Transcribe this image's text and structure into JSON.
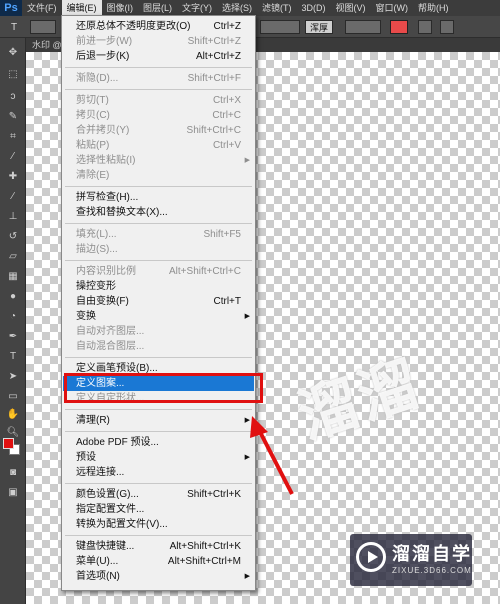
{
  "app": {
    "logo": "Ps"
  },
  "menubar": {
    "items": [
      "文件(F)",
      "编辑(E)",
      "图像(I)",
      "图层(L)",
      "文字(Y)",
      "选择(S)",
      "滤镜(T)",
      "3D(D)",
      "视图(V)",
      "窗口(W)",
      "帮助(H)"
    ],
    "active_index": 1
  },
  "options_bar": {
    "tool_glyph": "T",
    "aa_value": "浑厚",
    "text_color": "#e84a4a"
  },
  "document": {
    "tab_title": "水印 @"
  },
  "toolbox": {
    "foreground_color": "#e01010",
    "background_color": "#ffffff"
  },
  "edit_menu": {
    "items": [
      {
        "label": "还原总体不透明度更改(O)",
        "shortcut": "Ctrl+Z",
        "disabled": false
      },
      {
        "label": "前进一步(W)",
        "shortcut": "Shift+Ctrl+Z",
        "disabled": true
      },
      {
        "label": "后退一步(K)",
        "shortcut": "Alt+Ctrl+Z",
        "disabled": false
      },
      {
        "sep": true
      },
      {
        "label": "渐隐(D)...",
        "shortcut": "Shift+Ctrl+F",
        "disabled": true
      },
      {
        "sep": true
      },
      {
        "label": "剪切(T)",
        "shortcut": "Ctrl+X",
        "disabled": true
      },
      {
        "label": "拷贝(C)",
        "shortcut": "Ctrl+C",
        "disabled": true
      },
      {
        "label": "合并拷贝(Y)",
        "shortcut": "Shift+Ctrl+C",
        "disabled": true
      },
      {
        "label": "粘贴(P)",
        "shortcut": "Ctrl+V",
        "disabled": true
      },
      {
        "label": "选择性粘贴(I)",
        "shortcut": "",
        "submenu": true,
        "disabled": true
      },
      {
        "label": "清除(E)",
        "shortcut": "",
        "disabled": true
      },
      {
        "sep": true
      },
      {
        "label": "拼写检查(H)...",
        "shortcut": "",
        "disabled": false
      },
      {
        "label": "查找和替换文本(X)...",
        "shortcut": "",
        "disabled": false
      },
      {
        "sep": true
      },
      {
        "label": "填充(L)...",
        "shortcut": "Shift+F5",
        "disabled": true
      },
      {
        "label": "描边(S)...",
        "shortcut": "",
        "disabled": true
      },
      {
        "sep": true
      },
      {
        "label": "内容识别比例",
        "shortcut": "Alt+Shift+Ctrl+C",
        "disabled": true
      },
      {
        "label": "操控变形",
        "shortcut": "",
        "disabled": false
      },
      {
        "label": "自由变换(F)",
        "shortcut": "Ctrl+T",
        "disabled": false
      },
      {
        "label": "变换",
        "shortcut": "",
        "submenu": true,
        "disabled": false
      },
      {
        "label": "自动对齐图层...",
        "shortcut": "",
        "disabled": true
      },
      {
        "label": "自动混合图层...",
        "shortcut": "",
        "disabled": true
      },
      {
        "sep": true
      },
      {
        "label": "定义画笔预设(B)...",
        "shortcut": "",
        "disabled": false
      },
      {
        "label": "定义图案...",
        "shortcut": "",
        "disabled": false,
        "highlighted": true
      },
      {
        "label": "定义自定形状...",
        "shortcut": "",
        "disabled": true
      },
      {
        "sep": true
      },
      {
        "label": "清理(R)",
        "shortcut": "",
        "submenu": true,
        "disabled": false
      },
      {
        "sep": true
      },
      {
        "label": "Adobe PDF 预设...",
        "shortcut": "",
        "disabled": false
      },
      {
        "label": "预设",
        "shortcut": "",
        "submenu": true,
        "disabled": false
      },
      {
        "label": "远程连接...",
        "shortcut": "",
        "disabled": false
      },
      {
        "sep": true
      },
      {
        "label": "颜色设置(G)...",
        "shortcut": "Shift+Ctrl+K",
        "disabled": false
      },
      {
        "label": "指定配置文件...",
        "shortcut": "",
        "disabled": false
      },
      {
        "label": "转换为配置文件(V)...",
        "shortcut": "",
        "disabled": false
      },
      {
        "sep": true
      },
      {
        "label": "键盘快捷键...",
        "shortcut": "Alt+Shift+Ctrl+K",
        "disabled": false
      },
      {
        "label": "菜单(U)...",
        "shortcut": "Alt+Shift+Ctrl+M",
        "disabled": false
      },
      {
        "label": "首选项(N)",
        "shortcut": "",
        "submenu": true,
        "disabled": false
      }
    ]
  },
  "watermark": {
    "title": "溜溜自学",
    "url": "ZIXUE.3D66.COM"
  }
}
